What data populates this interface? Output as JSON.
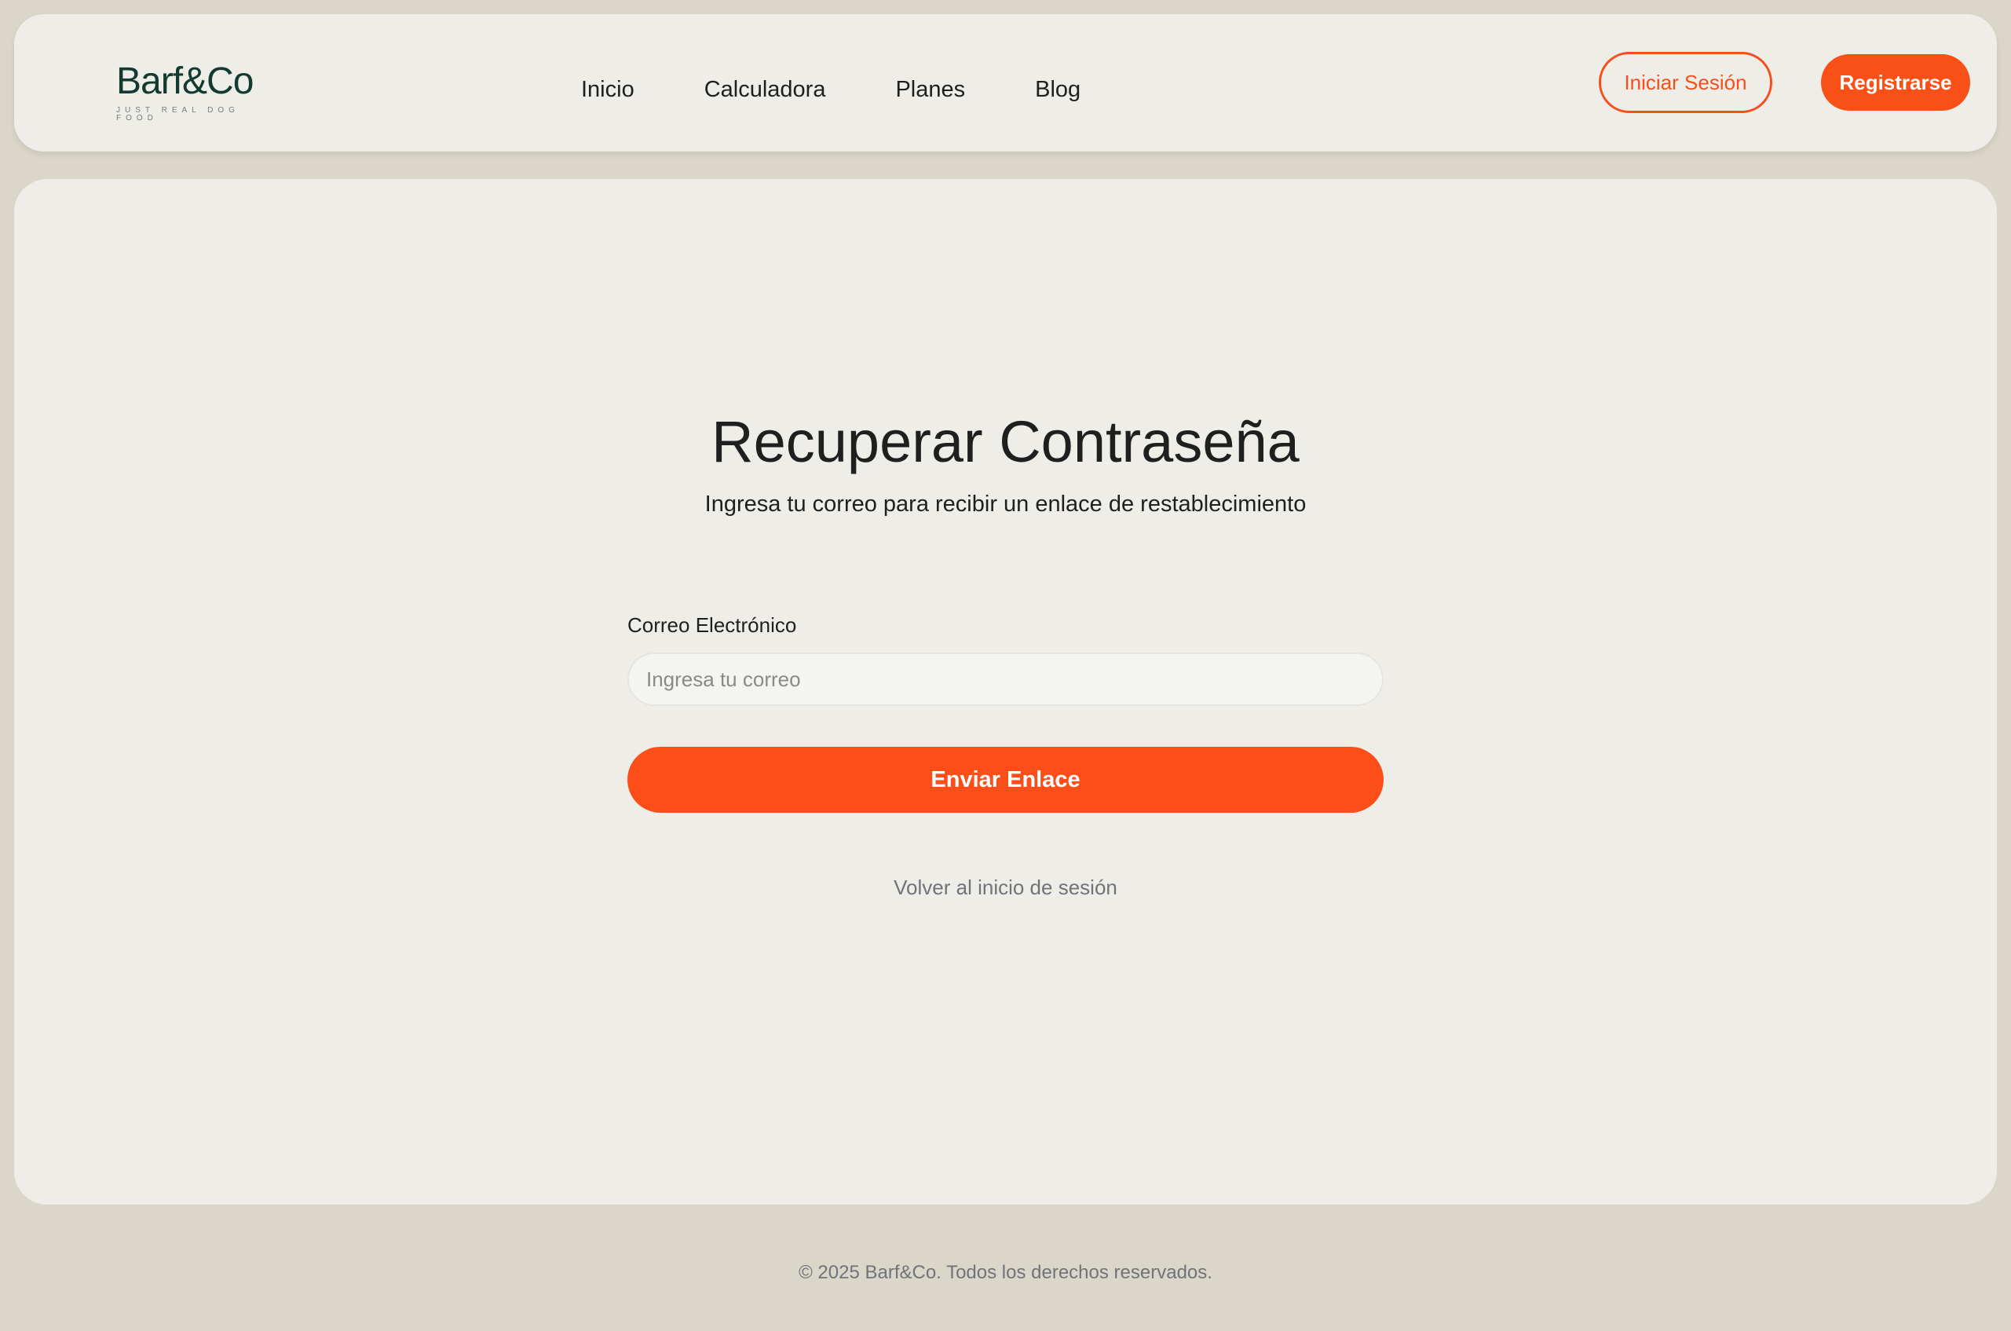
{
  "brand": {
    "name": "Barf&Co",
    "tagline": "JUST REAL DOG FOOD",
    "primary_color": "#f95017",
    "logo_color": "#123a30"
  },
  "nav": {
    "items": [
      {
        "label": "Inicio"
      },
      {
        "label": "Calculadora"
      },
      {
        "label": "Planes"
      },
      {
        "label": "Blog"
      }
    ]
  },
  "header_actions": {
    "login_label": "Iniciar Sesión",
    "register_label": "Registrarse"
  },
  "main": {
    "title": "Recuperar Contraseña",
    "subtitle": "Ingresa tu correo para recibir un enlace de restablecimiento",
    "email": {
      "label": "Correo Electrónico",
      "placeholder": "Ingresa tu correo",
      "value": ""
    },
    "submit_label": "Enviar Enlace",
    "back_link": "Volver al inicio de sesión"
  },
  "footer": {
    "copyright": "© 2025 Barf&Co. Todos los derechos reservados."
  }
}
